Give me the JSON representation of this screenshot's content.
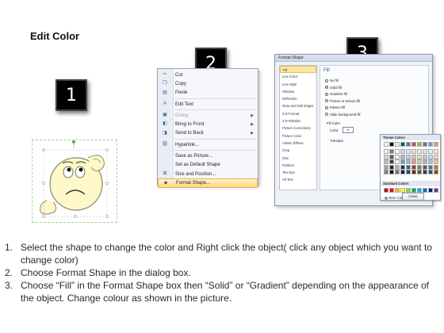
{
  "title": "Edit Color",
  "badges": [
    "1",
    "2",
    "3"
  ],
  "context_menu": {
    "items": [
      {
        "label": "Cut",
        "icon": "scissors-icon",
        "glyph": "✂",
        "disabled": false,
        "submenu": false
      },
      {
        "label": "Copy",
        "icon": "copy-icon",
        "glyph": "❐",
        "disabled": false,
        "submenu": false
      },
      {
        "label": "Paste",
        "icon": "paste-icon",
        "glyph": "▤",
        "disabled": false,
        "submenu": false
      },
      {
        "sep": true
      },
      {
        "label": "Edit Text",
        "icon": "text-icon",
        "glyph": "A",
        "disabled": false,
        "submenu": false
      },
      {
        "sep": true
      },
      {
        "label": "Group",
        "icon": "group-icon",
        "glyph": "▣",
        "disabled": true,
        "submenu": true
      },
      {
        "label": "Bring to Front",
        "icon": "bring-front-icon",
        "glyph": "◧",
        "disabled": false,
        "submenu": true
      },
      {
        "label": "Send to Back",
        "icon": "send-back-icon",
        "glyph": "◨",
        "disabled": false,
        "submenu": true
      },
      {
        "sep": true
      },
      {
        "label": "Hyperlink...",
        "icon": "link-icon",
        "glyph": "⛓",
        "disabled": false,
        "submenu": false
      },
      {
        "sep": true
      },
      {
        "label": "Save as Picture...",
        "icon": "",
        "glyph": "",
        "disabled": false,
        "submenu": false
      },
      {
        "label": "Set as Default Shape",
        "icon": "",
        "glyph": "",
        "disabled": false,
        "submenu": false
      },
      {
        "label": "Size and Position...",
        "icon": "size-icon",
        "glyph": "⊞",
        "disabled": false,
        "submenu": false
      },
      {
        "label": "Format Shape...",
        "icon": "format-shape-icon",
        "glyph": "◆",
        "disabled": false,
        "submenu": false,
        "selected": true
      }
    ]
  },
  "dialog": {
    "title": "Format Shape",
    "sidebar": [
      "Fill",
      "Line Color",
      "Line Style",
      "Shadow",
      "Reflection",
      "Glow and Soft Edges",
      "3-D Format",
      "3-D Rotation",
      "Picture Corrections",
      "Picture Color",
      "Artistic Effects",
      "Crop",
      "Size",
      "Position",
      "Text Box",
      "Alt Text"
    ],
    "fill_heading": "Fill",
    "options": [
      "No fill",
      "Solid fill",
      "Gradient fill",
      "Picture or texture fill",
      "Pattern fill",
      "Slide background fill"
    ],
    "selected_option": 1,
    "fill_color_label": "Fill Color",
    "color_label": "Color:",
    "transparency_label": "Transpar",
    "palette": {
      "theme_heading": "Theme Colors",
      "standard_heading": "Standard Colors",
      "more_label": "More Colors...",
      "theme_top": [
        "#ffffff",
        "#000000",
        "#eeece1",
        "#1f497d",
        "#4f81bd",
        "#c0504d",
        "#9bbb59",
        "#8064a2",
        "#4bacc6",
        "#f79646"
      ],
      "standard": [
        "#c00000",
        "#ff0000",
        "#ffc000",
        "#ffff00",
        "#92d050",
        "#00b050",
        "#00b0f0",
        "#0070c0",
        "#002060",
        "#7030a0"
      ]
    },
    "close_label": "Close"
  },
  "steps": [
    {
      "num": "1.",
      "text": "Select the shape to change the color and Right click the object( click any object which you want to change color)"
    },
    {
      "num": "2.",
      "text": "Choose Format Shape in the dialog box."
    },
    {
      "num": "3.",
      "text": "Choose “Fill” in the Format Shape box then “Solid” or “Gradient” depending on the appearance of the object. Change colour as shown in the picture."
    }
  ]
}
